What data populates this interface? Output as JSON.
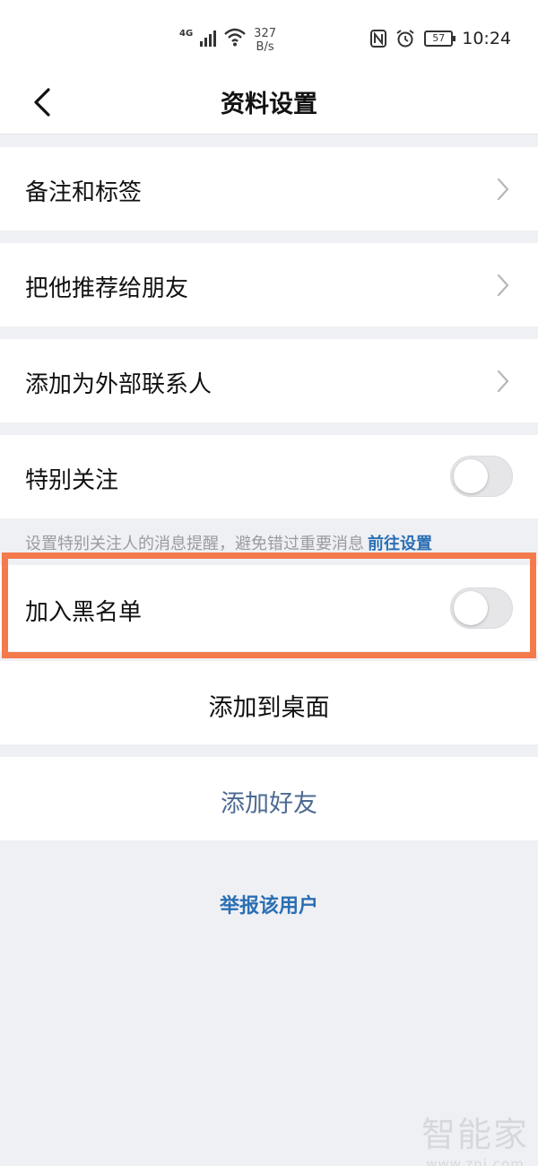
{
  "status_bar": {
    "network_type": "4G",
    "speed_value": "327",
    "speed_unit": "B/s",
    "battery": "57",
    "time": "10:24",
    "icons": [
      "nfc-icon",
      "alarm-icon",
      "wifi-icon",
      "signal-icon",
      "battery-icon"
    ]
  },
  "nav": {
    "title": "资料设置",
    "back_icon": "chevron-left-icon"
  },
  "settings": {
    "remark_tags": "备注和标签",
    "recommend": "把他推荐给朋友",
    "add_external": "添加为外部联系人",
    "special_follow": "特别关注",
    "special_follow_on": false,
    "hint_text": "设置特别关注人的消息提醒，避免错过重要消息",
    "hint_link": "前往设置",
    "blacklist": "加入黑名单",
    "blacklist_on": false,
    "add_desktop": "添加到桌面",
    "add_friend": "添加好友",
    "report": "举报该用户"
  },
  "watermark": {
    "logo": "智能家",
    "url": "www.znj.com"
  },
  "colors": {
    "background": "#eff0f4",
    "accent_link": "#2b6fb3",
    "add_friend_text": "#4d6a92",
    "highlight_border": "#f47a4c"
  }
}
